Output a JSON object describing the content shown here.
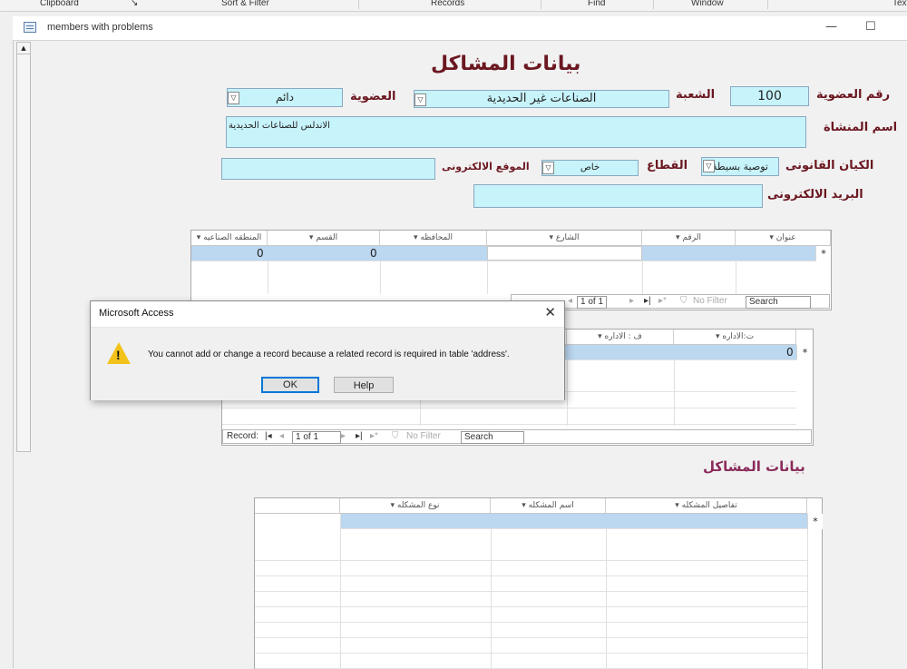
{
  "ribbon": {
    "groups": [
      "Clipboard",
      "Sort & Filter",
      "Records",
      "Find",
      "Window",
      "Text"
    ]
  },
  "window": {
    "title": "members with problems",
    "minimize": "—",
    "maximize": "☐"
  },
  "form": {
    "heading": "بيانات المشاكل",
    "membership_no_label": "رقم العضوية",
    "membership_no_value": "100",
    "division_label": "الشعبة",
    "division_value": "الصناعات غير الحديدية",
    "membership_label": "العضوية",
    "membership_value": "دائم",
    "facility_name_label": "اسم المنشاة",
    "facility_name_value": "الاندلس للصناعات الحديدية",
    "legal_entity_label": "الكيان القانونى",
    "legal_entity_value": "توصية بسيطة",
    "sector_label": "القطاع",
    "sector_value": "خاص",
    "website_label": "الموقع الالكترونى",
    "website_value": "",
    "email_label": "البريد الالكترونى",
    "email_value": ""
  },
  "address_grid": {
    "headers": [
      "عنوان",
      "الرقم",
      "الشارع",
      "المحافظه",
      "القسم",
      "المنطقه الصناعيه"
    ],
    "row_values": [
      "",
      "",
      "",
      "",
      "0",
      "0"
    ],
    "new_row_marker": "*",
    "nav": {
      "current": "1 of 1",
      "filter": "No Filter",
      "search": "Search"
    }
  },
  "admin_grid": {
    "headers": [
      "ت:الاداره",
      "ف : الاداره"
    ],
    "row_values": [
      "0"
    ],
    "new_row_marker": "*",
    "nav": {
      "record_label": "Record:",
      "current": "1 of 1",
      "filter": "No Filter",
      "search": "Search"
    }
  },
  "problems_section": {
    "heading": "بيانات المشاكل",
    "headers": [
      "تفاصيل المشكله",
      "اسم المشكله",
      "نوع المشكله"
    ],
    "new_row_marker": "*"
  },
  "dialog": {
    "title": "Microsoft Access",
    "message": "You cannot add or change a record because a related record is required in table 'address'.",
    "ok_label": "OK",
    "help_label": "Help",
    "close": "✕"
  }
}
